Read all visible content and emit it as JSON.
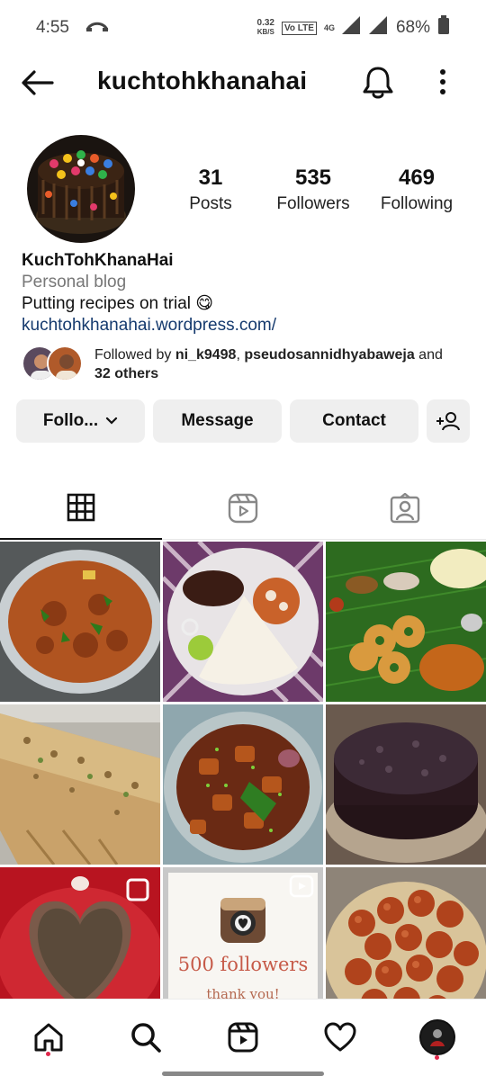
{
  "status_bar": {
    "time": "4:55",
    "speed_value": "0.32",
    "speed_unit": "KB/S",
    "network": "4G",
    "battery": "68%"
  },
  "header": {
    "username": "kuchtohkhanahai"
  },
  "profile": {
    "posts_count": "31",
    "posts_label": "Posts",
    "followers_count": "535",
    "followers_label": "Followers",
    "following_count": "469",
    "following_label": "Following",
    "display_name": "KuchTohKhanaHai",
    "category": "Personal blog",
    "bio": "Putting recipes on trial 😋",
    "website": "kuchtohkhanahai.wordpress.com/"
  },
  "followed_by": {
    "prefix": "Followed by ",
    "user1": "ni_k9498",
    "sep": ", ",
    "user2": "pseudosannidhyabaweja",
    "and": " and",
    "others": "32 others"
  },
  "actions": {
    "follow_label": "Follo...",
    "message_label": "Message",
    "contact_label": "Contact"
  },
  "grid_overlay_text": {
    "milestone": "500 followers",
    "thanks": "thank you!"
  },
  "colors": {
    "accent_link": "#153a6e",
    "notification_dot": "#e0274b",
    "button_bg": "#efefef"
  }
}
